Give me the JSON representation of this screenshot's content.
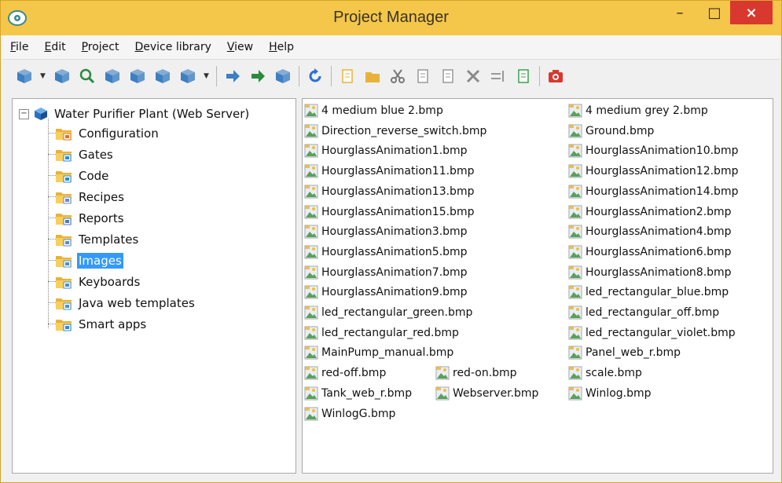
{
  "window": {
    "title": "Project Manager",
    "controls": {
      "minimize": "–",
      "maximize": "□",
      "close": "×"
    }
  },
  "menu": [
    {
      "label": "File",
      "access_key": "F"
    },
    {
      "label": "Edit",
      "access_key": "E"
    },
    {
      "label": "Project",
      "access_key": "P"
    },
    {
      "label": "Device library",
      "access_key": "D"
    },
    {
      "label": "View",
      "access_key": "V"
    },
    {
      "label": "Help",
      "access_key": "H"
    }
  ],
  "toolbar": [
    {
      "icon": "new-project-icon",
      "color": "#3d7fc2",
      "dropdown": true
    },
    {
      "icon": "open-project-icon",
      "color": "#3d7fc2"
    },
    {
      "icon": "search-project-icon",
      "color": "#2b8a3e"
    },
    {
      "icon": "project-settings-icon",
      "color": "#3d7fc2"
    },
    {
      "icon": "project-delete-icon",
      "color": "#3d7fc2"
    },
    {
      "icon": "project-export-icon",
      "color": "#3d7fc2"
    },
    {
      "icon": "run-project-icon",
      "color": "#3d7fc2",
      "dropdown": true
    },
    {
      "icon": "connect-icon",
      "color": "#3d7fc2"
    },
    {
      "icon": "disconnect-icon",
      "color": "#2b8a3e"
    },
    {
      "icon": "device-icon",
      "color": "#3d7fc2"
    },
    {
      "icon": "refresh-icon",
      "color": "#2a6fd6"
    },
    {
      "icon": "new-file-icon",
      "color": "#e8b23a"
    },
    {
      "icon": "new-folder-icon",
      "color": "#e8b23a"
    },
    {
      "icon": "cut-icon",
      "color": "#777777"
    },
    {
      "icon": "copy-icon",
      "color": "#999999"
    },
    {
      "icon": "paste-icon",
      "color": "#999999"
    },
    {
      "icon": "delete-icon",
      "color": "#8a8a8a"
    },
    {
      "icon": "rename-icon",
      "color": "#999999"
    },
    {
      "icon": "properties-icon",
      "color": "#3aa04a"
    },
    {
      "icon": "camera-icon",
      "color": "#d9382e"
    }
  ],
  "tree": {
    "root": "Water Purifier Plant (Web Server)",
    "children": [
      {
        "label": "Configuration",
        "badge_color": "#e07020"
      },
      {
        "label": "Gates",
        "badge_color": "#2b8ad6"
      },
      {
        "label": "Code",
        "badge_color": "#2b8ad6"
      },
      {
        "label": "Recipes",
        "badge_color": "#6a8ad0"
      },
      {
        "label": "Reports",
        "badge_color": "#4a7ac8"
      },
      {
        "label": "Templates",
        "badge_color": "#5a8ad0"
      },
      {
        "label": "Images",
        "badge_color": "#4a90d0",
        "selected": true
      },
      {
        "label": "Keyboards",
        "badge_color": "#4a90d0"
      },
      {
        "label": "Java web templates",
        "badge_color": "#4a90d0"
      },
      {
        "label": "Smart apps",
        "badge_color": "#2b8ad6"
      }
    ]
  },
  "files": {
    "column1": [
      "4 medium blue 2.bmp",
      "Direction_reverse_switch.bmp",
      "HourglassAnimation1.bmp",
      "HourglassAnimation11.bmp",
      "HourglassAnimation13.bmp",
      "HourglassAnimation15.bmp",
      "HourglassAnimation3.bmp",
      "HourglassAnimation5.bmp",
      "HourglassAnimation7.bmp",
      "HourglassAnimation9.bmp",
      "led_rectangular_green.bmp",
      "led_rectangular_red.bmp",
      "MainPump_manual.bmp",
      "red-off.bmp",
      "Tank_web_r.bmp",
      "WinlogG.bmp"
    ],
    "column2": [
      "red-on.bmp",
      "Webserver.bmp"
    ],
    "column3": [
      "4 medium grey 2.bmp",
      "Ground.bmp",
      "HourglassAnimation10.bmp",
      "HourglassAnimation12.bmp",
      "HourglassAnimation14.bmp",
      "HourglassAnimation2.bmp",
      "HourglassAnimation4.bmp",
      "HourglassAnimation6.bmp",
      "HourglassAnimation8.bmp",
      "led_rectangular_blue.bmp",
      "led_rectangular_off.bmp",
      "led_rectangular_violet.bmp",
      "Panel_web_r.bmp",
      "scale.bmp",
      "Winlog.bmp"
    ]
  }
}
